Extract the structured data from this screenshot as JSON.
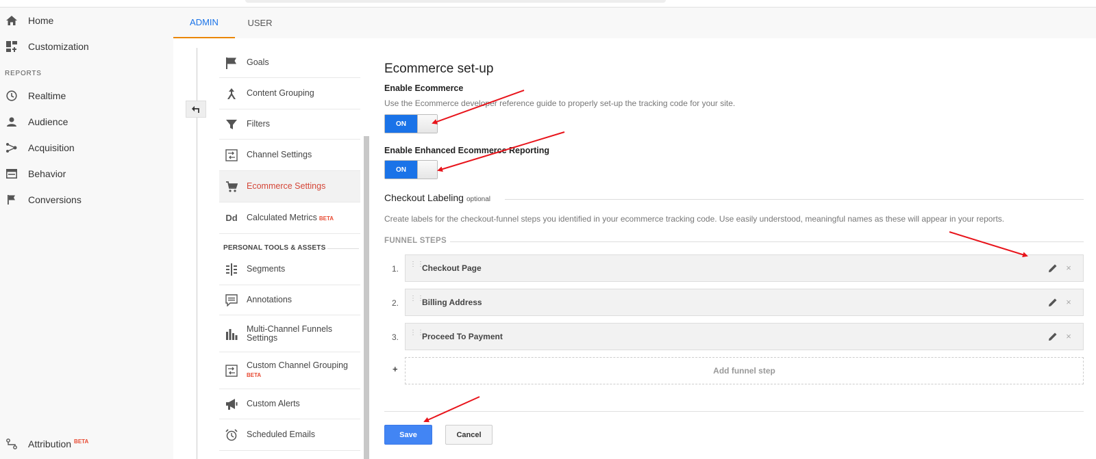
{
  "leftnav": {
    "home": "Home",
    "customization": "Customization",
    "reports_header": "REPORTS",
    "realtime": "Realtime",
    "audience": "Audience",
    "acquisition": "Acquisition",
    "behavior": "Behavior",
    "conversions": "Conversions",
    "attribution": "Attribution",
    "attribution_badge": "BETA"
  },
  "tabs": {
    "admin": "ADMIN",
    "user": "USER"
  },
  "admin_menu": {
    "goals": "Goals",
    "content_grouping": "Content Grouping",
    "filters": "Filters",
    "channel_settings": "Channel Settings",
    "ecommerce_settings": "Ecommerce Settings",
    "calculated_metrics": "Calculated Metrics",
    "calculated_metrics_badge": "BETA",
    "tools_header": "PERSONAL TOOLS & ASSETS",
    "segments": "Segments",
    "annotations": "Annotations",
    "mcf_line1": "Multi-Channel Funnels",
    "mcf_line2": "Settings",
    "ccg": "Custom Channel Grouping",
    "ccg_badge": "BETA",
    "custom_alerts": "Custom Alerts",
    "scheduled_emails": "Scheduled Emails",
    "dd_glyph": "Dd"
  },
  "main": {
    "title": "Ecommerce set-up",
    "enable_ecommerce": "Enable Ecommerce",
    "enable_desc": "Use the Ecommerce developer reference guide to properly set-up the tracking code for your site.",
    "toggle1_label": "ON",
    "enhanced_title": "Enable Enhanced Ecommerce Reporting",
    "toggle2_label": "ON",
    "checkout_title": "Checkout Labeling",
    "checkout_optional": "optional",
    "checkout_desc": "Create labels for the checkout-funnel steps you identified in your ecommerce tracking code. Use easily understood, meaningful names as these will appear in your reports.",
    "funnel_header": "FUNNEL STEPS",
    "steps": [
      {
        "num": "1.",
        "label": "Checkout Page"
      },
      {
        "num": "2.",
        "label": "Billing Address"
      },
      {
        "num": "3.",
        "label": "Proceed To Payment"
      }
    ],
    "add_step": "Add funnel step",
    "plus": "+",
    "save": "Save",
    "cancel": "Cancel"
  },
  "colors": {
    "accent_blue": "#1a73e8",
    "active_red": "#d44638",
    "annotation_arrow": "#e8141b"
  }
}
